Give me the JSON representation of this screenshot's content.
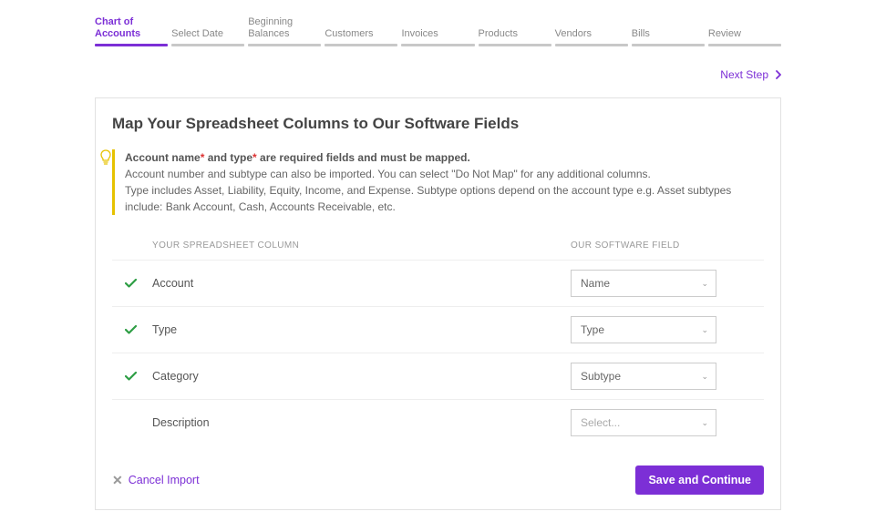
{
  "stepper": {
    "steps": [
      {
        "label": "Chart of Accounts",
        "active": true
      },
      {
        "label": "Select Date",
        "active": false
      },
      {
        "label": "Beginning Balances",
        "active": false
      },
      {
        "label": "Customers",
        "active": false
      },
      {
        "label": "Invoices",
        "active": false
      },
      {
        "label": "Products",
        "active": false
      },
      {
        "label": "Vendors",
        "active": false
      },
      {
        "label": "Bills",
        "active": false
      },
      {
        "label": "Review",
        "active": false
      }
    ]
  },
  "next_step_label": "Next Step",
  "card": {
    "title": "Map Your Spreadsheet Columns to Our Software Fields",
    "tip": {
      "bold_prefix": "Account name",
      "bold_mid": " and type",
      "bold_suffix": " are required fields and must be mapped.",
      "line2": "Account number and subtype can also be imported. You can select \"Do Not Map\" for any additional columns.",
      "line3": "Type includes Asset, Liability, Equity, Income, and Expense. Subtype options depend on the account type e.g. Asset subtypes include: Bank Account, Cash, Accounts Receivable, etc."
    },
    "columns": {
      "src_header": "YOUR SPREADSHEET COLUMN",
      "dst_header": "OUR SOFTWARE FIELD"
    },
    "rows": [
      {
        "checked": true,
        "src": "Account",
        "dst": "Name",
        "placeholder": false
      },
      {
        "checked": true,
        "src": "Type",
        "dst": "Type",
        "placeholder": false
      },
      {
        "checked": true,
        "src": "Category",
        "dst": "Subtype",
        "placeholder": false
      },
      {
        "checked": false,
        "src": "Description",
        "dst": "Select...",
        "placeholder": true
      }
    ]
  },
  "footer": {
    "cancel_label": "Cancel Import",
    "save_label": "Save and Continue"
  }
}
